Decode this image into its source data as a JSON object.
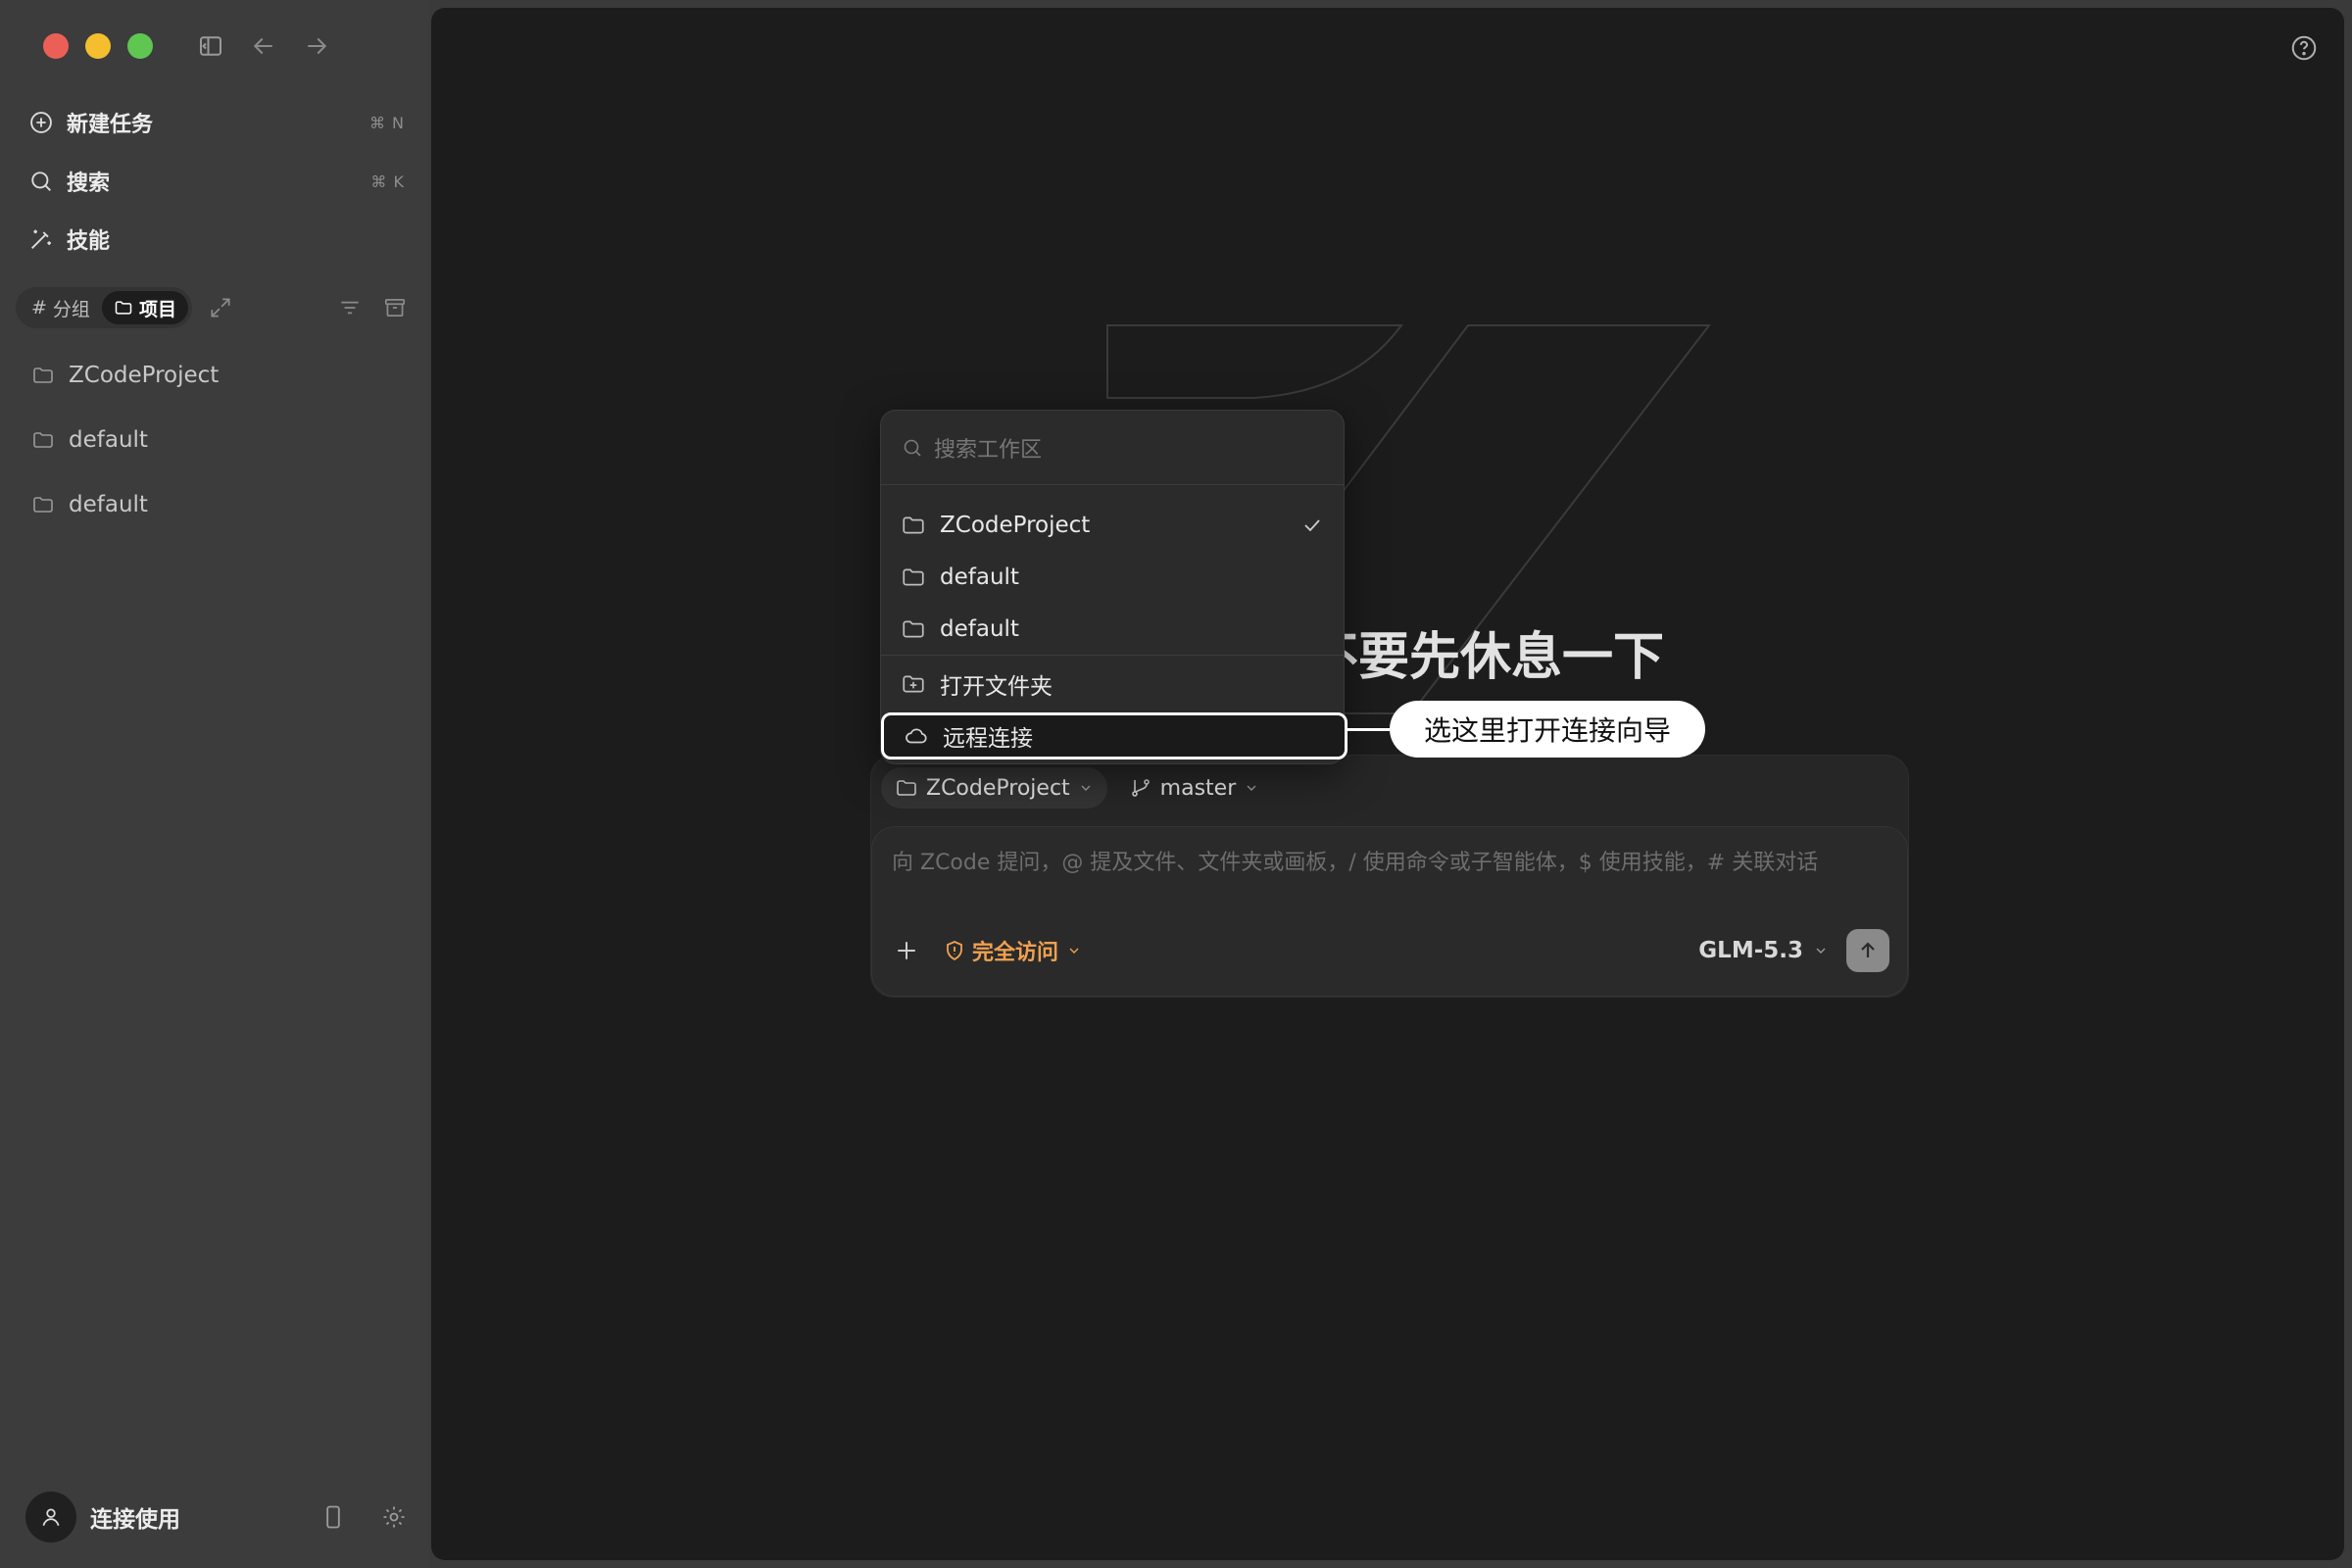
{
  "sidebar": {
    "nav": [
      {
        "label": "新建任务",
        "shortcut": "⌘ N",
        "icon": "new-task-icon"
      },
      {
        "label": "搜索",
        "shortcut": "⌘ K",
        "icon": "search-icon"
      },
      {
        "label": "技能",
        "shortcut": "",
        "icon": "magic-wand-icon"
      }
    ],
    "filter_tabs": [
      "分组",
      "项目"
    ],
    "active_tab": "项目",
    "projects": [
      "ZCodeProject",
      "default",
      "default"
    ],
    "user_name": "连接使用"
  },
  "main": {
    "greeting": "要不要先休息一下",
    "dropdown": {
      "search_placeholder": "搜索工作区",
      "workspaces": [
        "ZCodeProject",
        "default",
        "default"
      ],
      "selected": "ZCodeProject",
      "open_folder": "打开文件夹",
      "remote_connect": "远程连接"
    },
    "callout": "选这里打开连接向导",
    "composer": {
      "project": "ZCodeProject",
      "branch": "master",
      "placeholder": "向 ZCode 提问，@ 提及文件、文件夹或画板，/ 使用命令或子智能体，$ 使用技能，# 关联对话",
      "access": "完全访问",
      "model": "GLM-5.3"
    }
  },
  "colors": {
    "sidebar_bg": "#3c3c3c",
    "main_bg": "#1c1c1c",
    "accent_orange": "#f0a050",
    "highlight_border": "#ffffff"
  }
}
